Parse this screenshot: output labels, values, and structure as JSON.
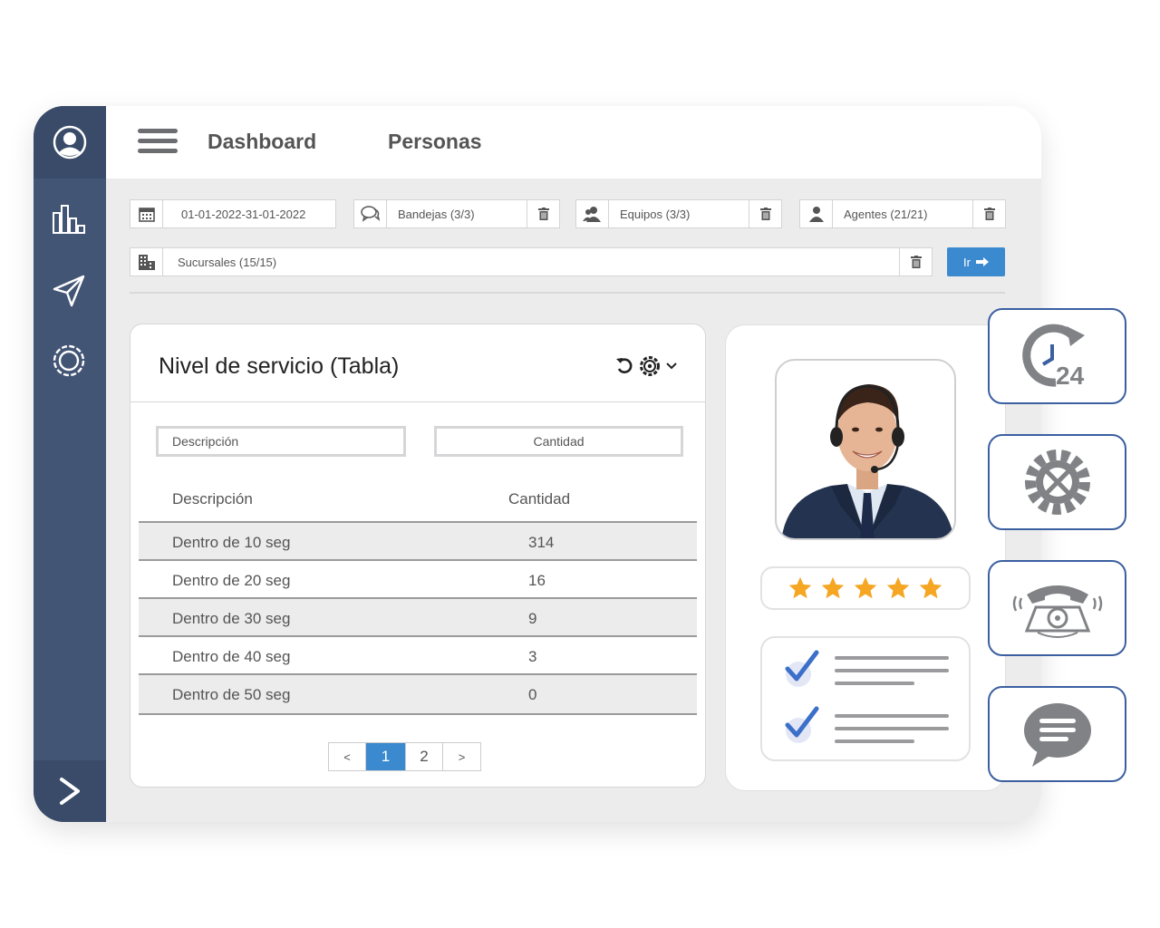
{
  "nav": {
    "tabs": [
      {
        "label": "Dashboard"
      },
      {
        "label": "Personas"
      }
    ]
  },
  "filters": {
    "date_range": "01-01-2022-31-01-2022",
    "bandejas": "Bandejas (3/3)",
    "equipos": "Equipos (3/3)",
    "agentes": "Agentes (21/21)",
    "sucursales": "Sucursales (15/15)",
    "go_label": "Ir"
  },
  "card": {
    "title": "Nivel de servicio (Tabla)",
    "filter_desc_placeholder": "Descripción",
    "filter_qty_placeholder": "Cantidad",
    "columns": [
      "Descripción",
      "Cantidad"
    ],
    "rows": [
      {
        "desc": "Dentro de 10 seg",
        "qty": "314"
      },
      {
        "desc": "Dentro de 20 seg",
        "qty": "16"
      },
      {
        "desc": "Dentro de 30 seg",
        "qty": "9"
      },
      {
        "desc": "Dentro de 40 seg",
        "qty": "3"
      },
      {
        "desc": "Dentro de 50 seg",
        "qty": "0"
      }
    ],
    "pager": {
      "prev": "<",
      "pages": [
        "1",
        "2"
      ],
      "next": ">",
      "current": 1
    }
  },
  "agent": {
    "rating_stars": 5
  },
  "tiles": {
    "support_24": "24"
  },
  "colors": {
    "sidebar": "#435575",
    "accent": "#3b8ad0",
    "star": "#f5a623",
    "tile_border": "#3b5fa0"
  }
}
